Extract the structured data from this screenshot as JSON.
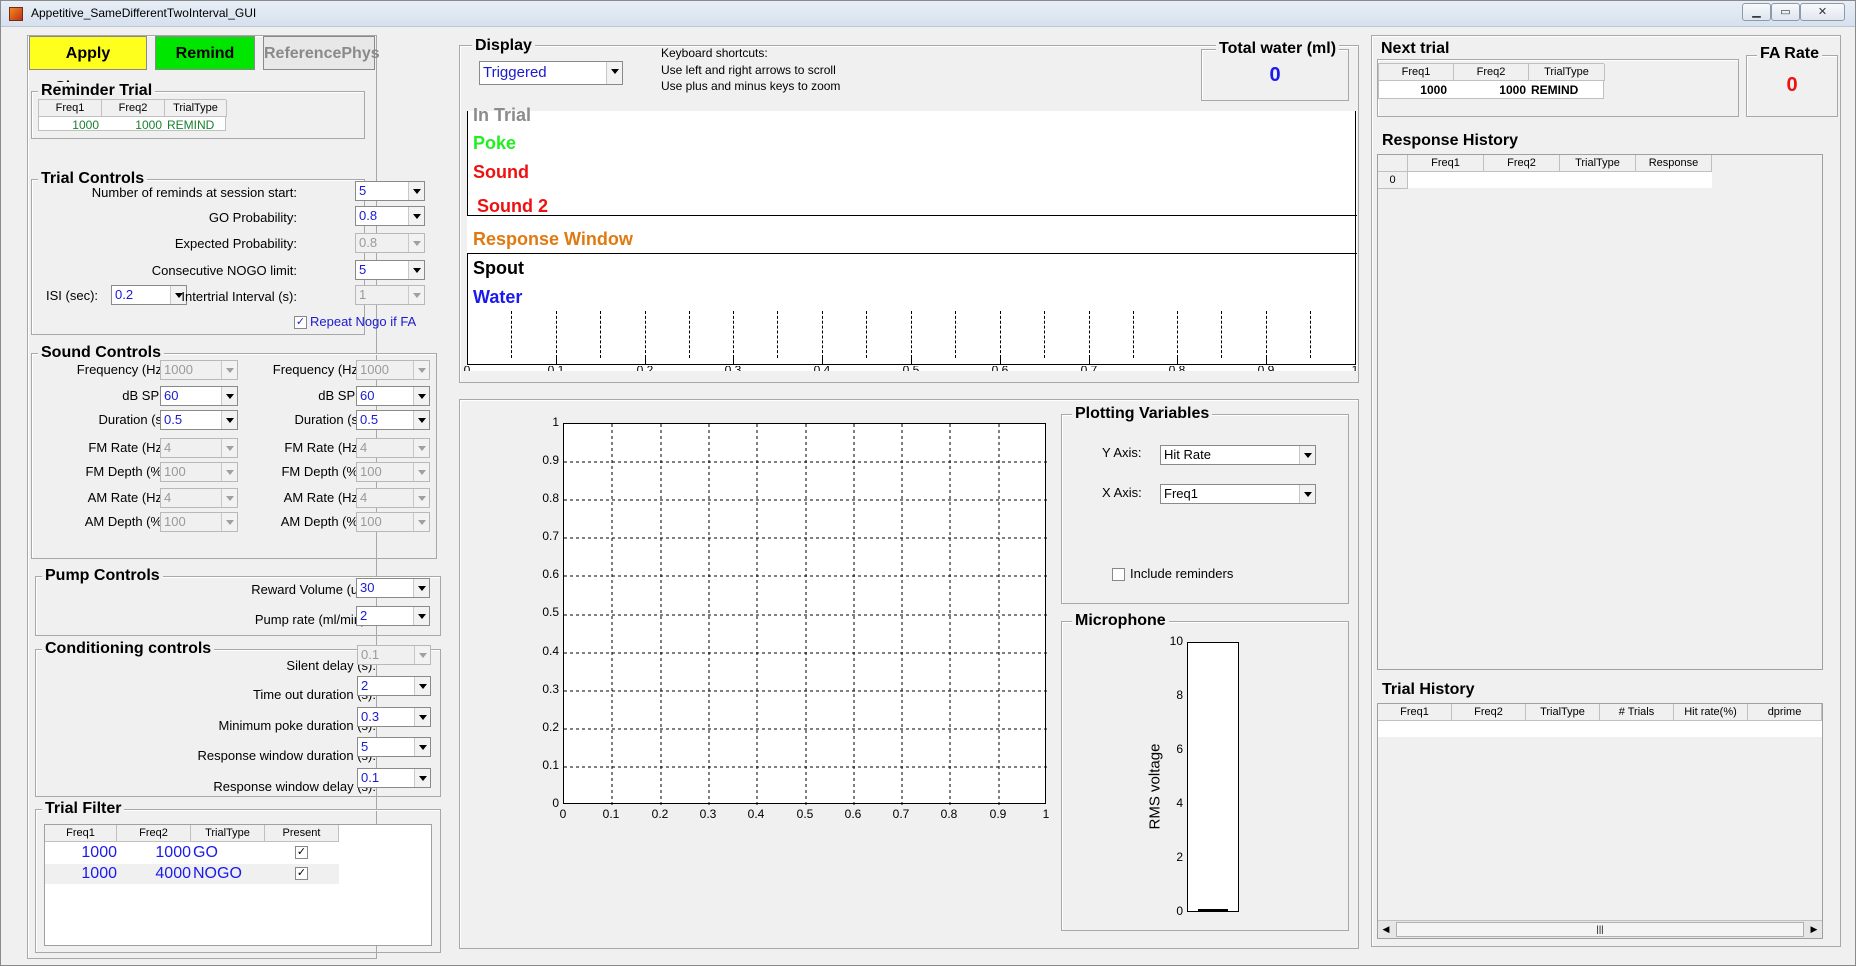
{
  "window": {
    "title": "Appetitive_SameDifferentTwoInterval_GUI",
    "min": "▁",
    "max": "▭",
    "close": "✕"
  },
  "buttons": {
    "apply": "Apply Changes",
    "remind": "Remind",
    "reference": "ReferencePhys"
  },
  "reminder": {
    "title": "Reminder Trial",
    "headers": [
      "Freq1",
      "Freq2",
      "TrialType"
    ],
    "row": [
      "1000",
      "1000",
      "REMIND"
    ]
  },
  "trial_controls": {
    "title": "Trial Controls",
    "num_reminds": {
      "label": "Number of reminds at session start:",
      "value": "5"
    },
    "go_prob": {
      "label": "GO Probability:",
      "value": "0.8"
    },
    "expected_prob": {
      "label": "Expected Probability:",
      "value": "0.8"
    },
    "nogo_limit": {
      "label": "Consecutive NOGO limit:",
      "value": "5"
    },
    "isi": {
      "label": "ISI (sec):",
      "value": "0.2"
    },
    "iti": {
      "label": "Intertrial Interval (s):",
      "value": "1"
    },
    "repeat_nogo": {
      "label": "Repeat Nogo if FA",
      "checked": "✓"
    }
  },
  "sound_controls": {
    "title": "Sound Controls",
    "rows": [
      {
        "label": "Frequency (Hz):",
        "v1": "1000",
        "v2": "1000"
      },
      {
        "label": "dB SPL:",
        "v1": "60",
        "v2": "60"
      },
      {
        "label": "Duration (s):",
        "v1": "0.5",
        "v2": "0.5"
      },
      {
        "label": "FM Rate (Hz):",
        "v1": "4",
        "v2": "4"
      },
      {
        "label": "FM Depth (%):",
        "v1": "100",
        "v2": "100"
      },
      {
        "label": "AM Rate (Hz):",
        "v1": "4",
        "v2": "4"
      },
      {
        "label": "AM Depth (%):",
        "v1": "100",
        "v2": "100"
      }
    ]
  },
  "pump": {
    "title": "Pump Controls",
    "reward": {
      "label": "Reward Volume (ul):",
      "value": "30"
    },
    "rate": {
      "label": "Pump rate (ml/min):",
      "value": "2"
    }
  },
  "conditioning": {
    "title": "Conditioning controls",
    "silent": {
      "label": "Silent delay (s):",
      "value": "0.1"
    },
    "timeout": {
      "label": "Time out duration (s):",
      "value": "2"
    },
    "min_poke": {
      "label": "Minimum poke duration (s):",
      "value": "0.3"
    },
    "resp_dur": {
      "label": "Response window duration (s):",
      "value": "5"
    },
    "resp_delay": {
      "label": "Response window delay (s):",
      "value": "0.1"
    }
  },
  "trial_filter": {
    "title": "Trial Filter",
    "headers": [
      "Freq1",
      "Freq2",
      "TrialType",
      "Present"
    ],
    "rows": [
      {
        "f1": "1000",
        "f2": "1000",
        "type": "GO",
        "present": "✓"
      },
      {
        "f1": "1000",
        "f2": "4000",
        "type": "NOGO",
        "present": "✓"
      }
    ]
  },
  "display": {
    "title": "Display",
    "mode": "Triggered",
    "shortcuts": [
      "Keyboard shortcuts:",
      "Use left and right arrows to scroll",
      "Use plus and minus keys to zoom"
    ],
    "events": [
      {
        "name": "In Trial",
        "color": "#8c8c8c"
      },
      {
        "name": "Poke",
        "color": "#22ee22"
      },
      {
        "name": "Sound",
        "color": "#ee1111"
      },
      {
        "name": "Sound 2",
        "color": "#ee1111"
      },
      {
        "name": "Response Window",
        "color": "#e07a10"
      },
      {
        "name": "Spout",
        "color": "#000000"
      },
      {
        "name": "Water",
        "color": "#1a1aee"
      }
    ],
    "axis_ticks": [
      "0",
      "0.1",
      "0.2",
      "0.3",
      "0.4",
      "0.5",
      "0.6",
      "0.7",
      "0.8",
      "0.9",
      "1"
    ]
  },
  "water": {
    "title": "Total water (ml)",
    "value": "0"
  },
  "plot": {
    "xticks": [
      "0",
      "0.1",
      "0.2",
      "0.3",
      "0.4",
      "0.5",
      "0.6",
      "0.7",
      "0.8",
      "0.9",
      "1"
    ],
    "yticks": [
      "0",
      "0.1",
      "0.2",
      "0.3",
      "0.4",
      "0.5",
      "0.6",
      "0.7",
      "0.8",
      "0.9",
      "1"
    ]
  },
  "plotting_vars": {
    "title": "Plotting Variables",
    "y_label": "Y Axis:",
    "y_value": "Hit Rate",
    "x_label": "X Axis:",
    "x_value": "Freq1",
    "include": "Include reminders"
  },
  "microphone": {
    "title": "Microphone",
    "ylabel": "RMS voltage",
    "ticks": [
      "0",
      "2",
      "4",
      "6",
      "8",
      "10"
    ],
    "level": 0
  },
  "next_trial": {
    "title": "Next trial",
    "headers": [
      "Freq1",
      "Freq2",
      "TrialType"
    ],
    "row": [
      "1000",
      "1000",
      "REMIND"
    ]
  },
  "fa_rate": {
    "title": "FA Rate",
    "value": "0"
  },
  "response_history": {
    "title": "Response History",
    "headers": [
      "Freq1",
      "Freq2",
      "TrialType",
      "Response"
    ],
    "row_index": "0"
  },
  "trial_history": {
    "title": "Trial History",
    "headers": [
      "Freq1",
      "Freq2",
      "TrialType",
      "# Trials",
      "Hit rate(%)",
      "dprime"
    ],
    "scroll_grip": "|||"
  }
}
